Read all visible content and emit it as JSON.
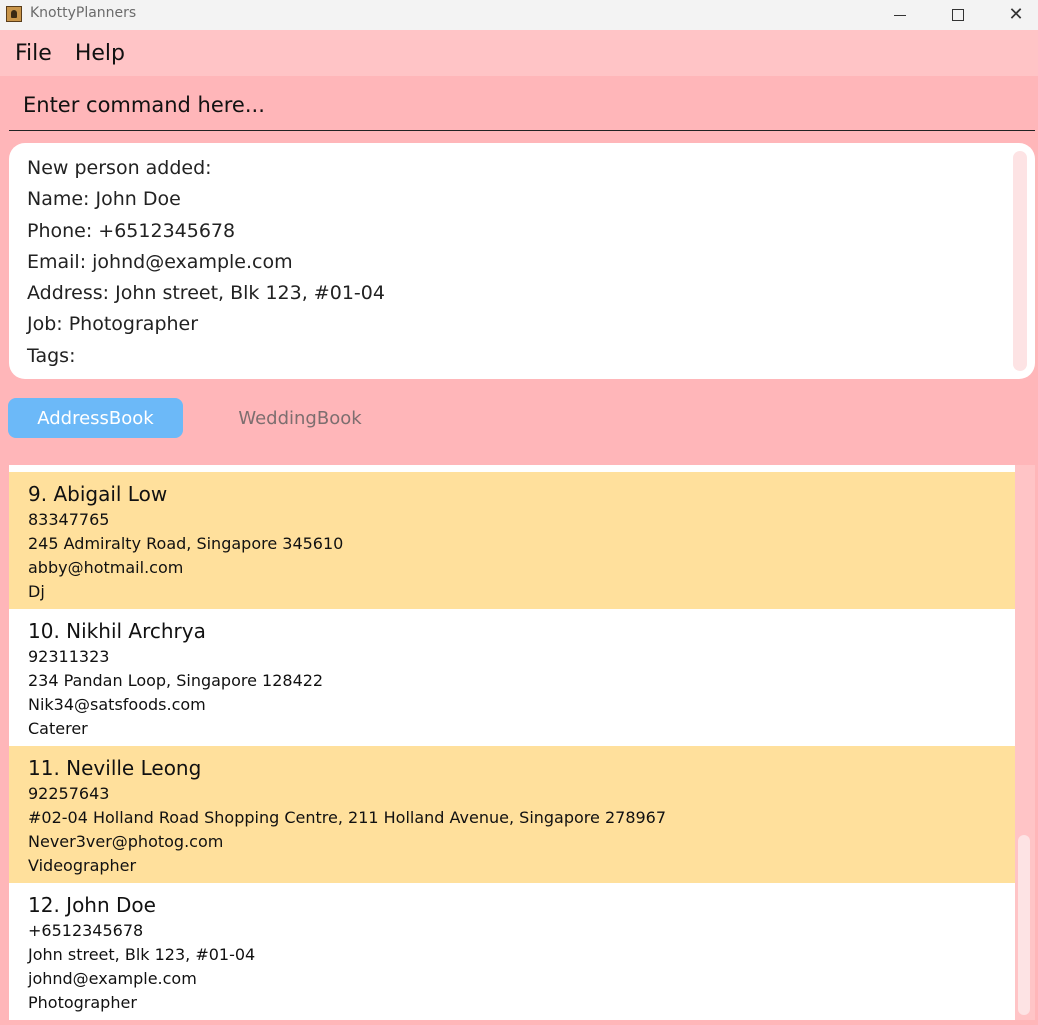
{
  "window": {
    "title": "KnottyPlanners"
  },
  "menu": {
    "items": [
      "File",
      "Help"
    ]
  },
  "command": {
    "placeholder": "Enter command here..."
  },
  "result": {
    "lines": [
      "New person added:",
      "Name: John Doe",
      "Phone: +6512345678",
      "Email: johnd@example.com",
      "Address: John street, Blk 123, #01-04",
      "Job: Photographer",
      "Tags:"
    ]
  },
  "tabs": [
    {
      "label": "AddressBook",
      "active": true
    },
    {
      "label": "WeddingBook",
      "active": false
    }
  ],
  "persons": [
    {
      "name": "9. Abigail Low",
      "phone": "83347765",
      "address": "245 Admiralty Road, Singapore 345610",
      "email": "abby@hotmail.com",
      "job": "Dj"
    },
    {
      "name": "10. Nikhil Archrya",
      "phone": "92311323",
      "address": "234 Pandan Loop, Singapore 128422",
      "email": "Nik34@satsfoods.com",
      "job": "Caterer"
    },
    {
      "name": "11. Neville Leong",
      "phone": "92257643",
      "address": "#02-04 Holland Road Shopping Centre, 211 Holland Avenue, Singapore 278967",
      "email": "Never3ver@photog.com",
      "job": "Videographer"
    },
    {
      "name": "12. John Doe",
      "phone": "+6512345678",
      "address": "John street, Blk 123, #01-04",
      "email": "johnd@example.com",
      "job": "Photographer"
    }
  ],
  "colors": {
    "background": "#ffb6b9",
    "card_alt": "#ffe09c",
    "tab_active": "#6cb9f8"
  }
}
